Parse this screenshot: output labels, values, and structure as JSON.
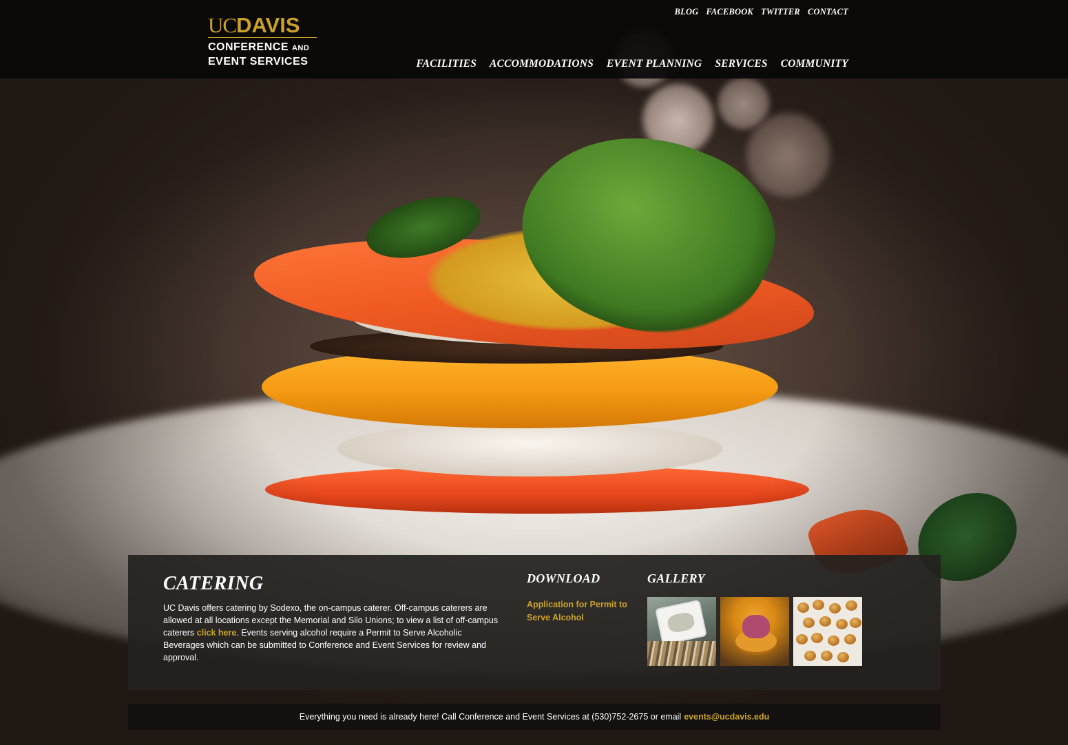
{
  "logo": {
    "uc": "UC",
    "davis": "DAVIS",
    "line1": "CONFERENCE",
    "line1_small": "AND",
    "line2": "EVENT SERVICES"
  },
  "util_nav": [
    "BLOG",
    "FACEBOOK",
    "TWITTER",
    "CONTACT"
  ],
  "main_nav": [
    "FACILITIES",
    "ACCOMMODATIONS",
    "EVENT PLANNING",
    "SERVICES",
    "COMMUNITY"
  ],
  "catering": {
    "title": "CATERING",
    "text_before_link": "UC Davis offers catering by Sodexo, the on-campus caterer. Off-campus caterers are allowed at all locations except the Memorial and Silo Unions; to view a list of off-campus caterers ",
    "link_label": "click here",
    "text_after_link": ". Events serving alcohol require a Permit to Serve Alcoholic Beverages which can be submitted to Conference and Event Services for review and approval."
  },
  "download": {
    "title": "DOWNLOAD",
    "link_label": "Application for Permit to Serve Alcohol"
  },
  "gallery": {
    "title": "GALLERY"
  },
  "footer": {
    "text": "Everything you need is already here! Call Conference and Event Services at (530)752-2675 or email",
    "email": "events@ucdavis.edu"
  },
  "colors": {
    "accent_gold": "#c9a227",
    "header_bg": "#0a0807",
    "panel_bg": "#24211f"
  }
}
